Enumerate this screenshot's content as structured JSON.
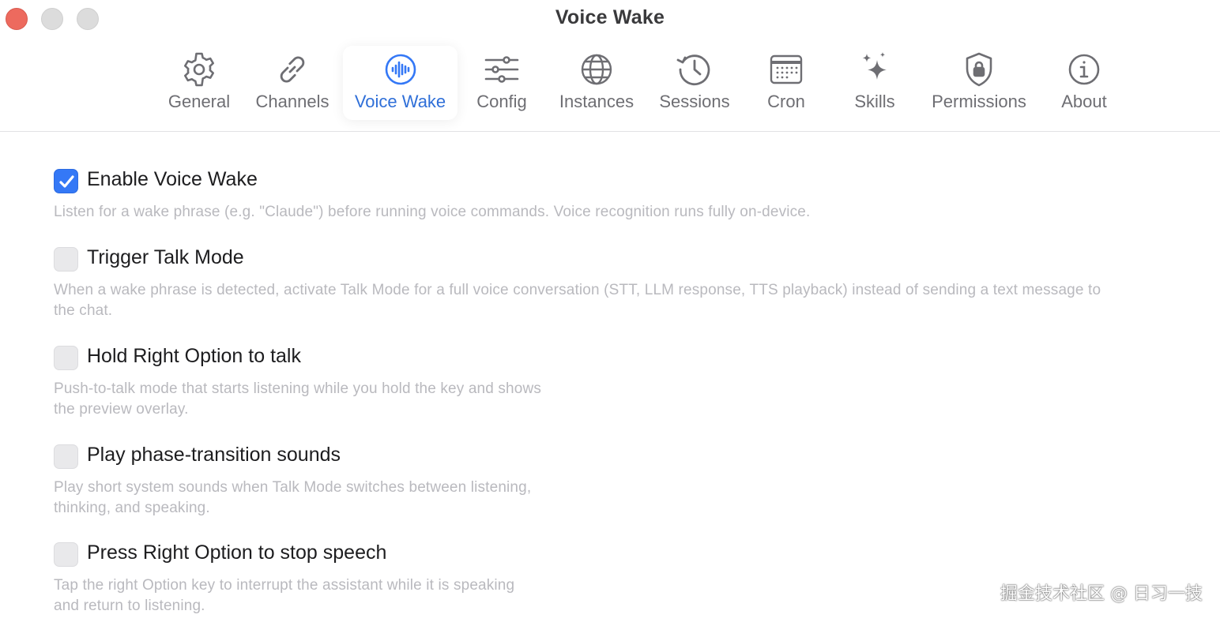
{
  "window": {
    "title": "Voice Wake"
  },
  "toolbar": {
    "tabs": [
      {
        "key": "general",
        "label": "General",
        "icon": "gear-icon",
        "selected": false
      },
      {
        "key": "channels",
        "label": "Channels",
        "icon": "link-icon",
        "selected": false
      },
      {
        "key": "voice-wake",
        "label": "Voice Wake",
        "icon": "waveform-icon",
        "selected": true
      },
      {
        "key": "config",
        "label": "Config",
        "icon": "sliders-icon",
        "selected": false
      },
      {
        "key": "instances",
        "label": "Instances",
        "icon": "globe-icon",
        "selected": false
      },
      {
        "key": "sessions",
        "label": "Sessions",
        "icon": "clock-history-icon",
        "selected": false
      },
      {
        "key": "cron",
        "label": "Cron",
        "icon": "calendar-icon",
        "selected": false
      },
      {
        "key": "skills",
        "label": "Skills",
        "icon": "sparkles-icon",
        "selected": false
      },
      {
        "key": "permissions",
        "label": "Permissions",
        "icon": "shield-lock-icon",
        "selected": false
      },
      {
        "key": "about",
        "label": "About",
        "icon": "info-icon",
        "selected": false
      }
    ]
  },
  "settings": [
    {
      "key": "enable-voice-wake",
      "title": "Enable Voice Wake",
      "description": "Listen for a wake phrase (e.g. \"Claude\") before running voice commands. Voice recognition runs fully on-device.",
      "checked": true
    },
    {
      "key": "trigger-talk-mode",
      "title": "Trigger Talk Mode",
      "description": "When a wake phrase is detected, activate Talk Mode for a full voice conversation (STT, LLM response, TTS playback) instead of sending a text message to the chat.",
      "checked": false
    },
    {
      "key": "hold-right-option",
      "title": "Hold Right Option to talk",
      "description": "Push-to-talk mode that starts listening while you hold the key and shows the preview overlay.",
      "checked": false
    },
    {
      "key": "phase-transition-sounds",
      "title": "Play phase-transition sounds",
      "description": "Play short system sounds when Talk Mode switches between listening, thinking, and speaking.",
      "checked": false
    },
    {
      "key": "press-right-option-stop",
      "title": "Press Right Option to stop speech",
      "description": "Tap the right Option key to interrupt the assistant while it is speaking and return to listening.",
      "checked": false
    }
  ],
  "watermark": "掘金技术社区 @ 日习一技",
  "colors": {
    "accent": "#3478f6",
    "selected_label": "#2f6fd8",
    "icon_gray": "#6e6e73",
    "description_gray": "#b9b9be",
    "close_button": "#ed6a5e"
  }
}
